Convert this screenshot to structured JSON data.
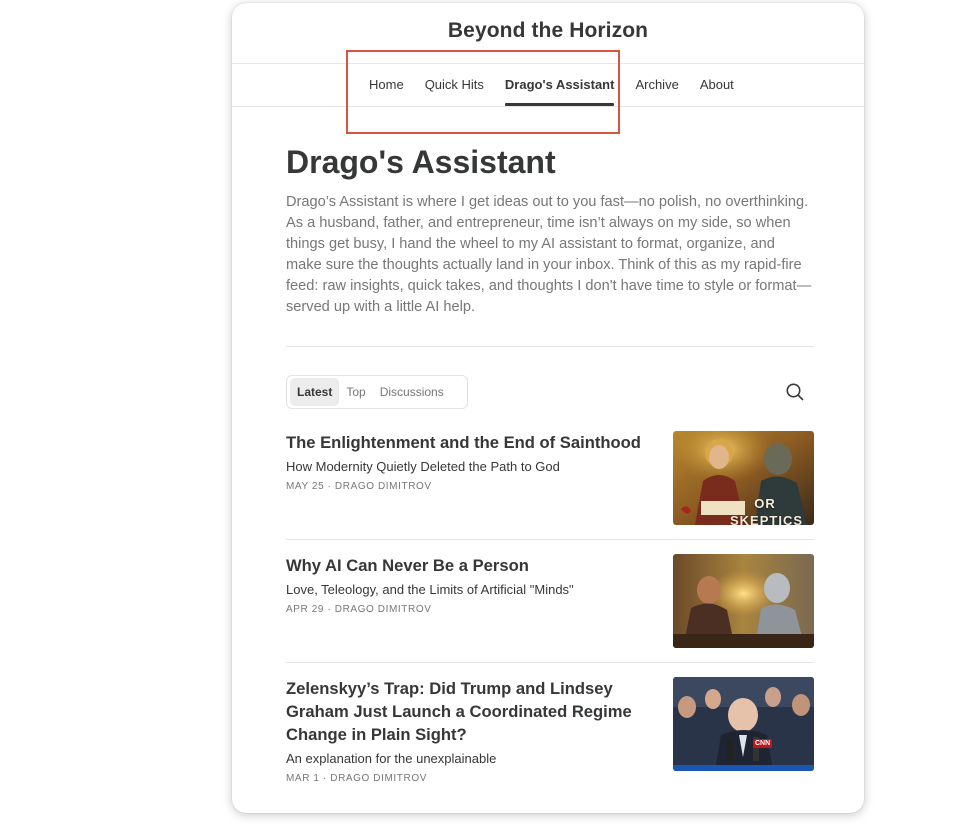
{
  "site": {
    "title": "Beyond the Horizon"
  },
  "nav": {
    "items": [
      {
        "label": "Home"
      },
      {
        "label": "Quick Hits"
      },
      {
        "label": "Drago's Assistant"
      },
      {
        "label": "Archive"
      },
      {
        "label": "About"
      }
    ],
    "active": "Drago's Assistant"
  },
  "page": {
    "title": "Drago's Assistant",
    "description": "Drago’s Assistant is where I get ideas out to you fast—no polish, no overthinking. As a husband, father, and entrepreneur, time isn’t always on my side, so when things get busy, I hand the wheel to my AI assistant to format, organize, and make sure the thoughts actually land in your inbox. Think of this as my rapid-fire feed: raw insights, quick takes, and thoughts I don't have time to style or format—served up with a little AI help."
  },
  "tabs": {
    "items": [
      {
        "label": "Latest"
      },
      {
        "label": "Top"
      },
      {
        "label": "Discussions"
      }
    ],
    "active": "Latest",
    "search_icon": "search-icon"
  },
  "posts": [
    {
      "title": "The Enlightenment and the End of Sainthood",
      "subtitle": "How Modernity Quietly Deleted the Path to God",
      "meta": "MAY 25 · DRAGO DIMITROV",
      "thumb_text": "OR SKEPTICS"
    },
    {
      "title": "Why AI Can Never Be a Person",
      "subtitle": "Love, Teleology, and the Limits of Artificial \"Minds\"",
      "meta": "APR 29 · DRAGO DIMITROV"
    },
    {
      "title": "Zelenskyy’s Trap: Did Trump and Lindsey Graham Just Launch a Coordinated Regime Change in Plain Sight?",
      "subtitle": "An explanation for the unexplainable",
      "meta": "MAR 1 · DRAGO DIMITROV",
      "thumb_text": "CNN"
    }
  ],
  "colors": {
    "text": "#363737",
    "muted": "#777777",
    "highlight": "#d9533f"
  }
}
